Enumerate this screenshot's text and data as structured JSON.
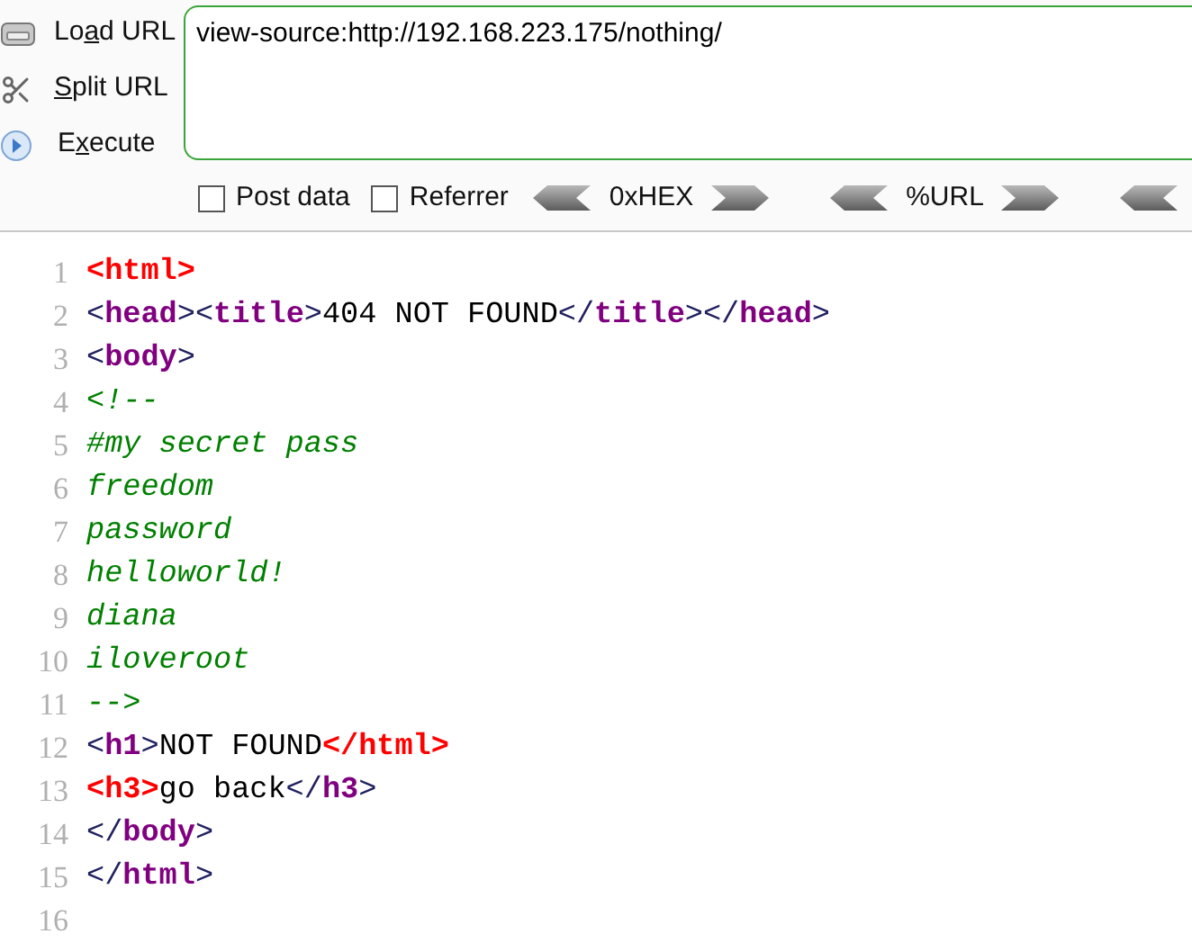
{
  "toolbar": {
    "actions": [
      {
        "kind": "load",
        "label": {
          "before": "Lo",
          "key": "a",
          "after": "d URL"
        }
      },
      {
        "kind": "split",
        "label": {
          "key": "S",
          "after": "plit URL"
        }
      },
      {
        "kind": "execute",
        "label": {
          "before": "E",
          "key": "x",
          "after": "ecute"
        }
      }
    ],
    "url_field": {
      "value": "view-source:http://192.168.223.175/nothing/"
    },
    "options": [
      {
        "label": "Post data",
        "checked": false
      },
      {
        "label": "Referrer",
        "checked": false
      }
    ],
    "converters": [
      {
        "label": "0xHEX"
      },
      {
        "label": "%URL"
      }
    ]
  },
  "source": {
    "lines": [
      {
        "number": "1",
        "tokens": [
          {
            "kind": "error",
            "text": "<html>"
          }
        ]
      },
      {
        "number": "2",
        "tokens": [
          {
            "kind": "bracket",
            "text": "<"
          },
          {
            "kind": "tag",
            "text": "head"
          },
          {
            "kind": "bracket",
            "text": "><"
          },
          {
            "kind": "tag",
            "text": "title"
          },
          {
            "kind": "bracket",
            "text": ">"
          },
          {
            "kind": "text",
            "text": "404 NOT FOUND"
          },
          {
            "kind": "bracket",
            "text": "</"
          },
          {
            "kind": "tag",
            "text": "title"
          },
          {
            "kind": "bracket",
            "text": "></"
          },
          {
            "kind": "tag",
            "text": "head"
          },
          {
            "kind": "bracket",
            "text": ">"
          }
        ]
      },
      {
        "number": "3",
        "tokens": [
          {
            "kind": "bracket",
            "text": "<"
          },
          {
            "kind": "tag",
            "text": "body"
          },
          {
            "kind": "bracket",
            "text": ">"
          }
        ]
      },
      {
        "number": "4",
        "tokens": [
          {
            "kind": "comment",
            "text": "<!--"
          }
        ]
      },
      {
        "number": "5",
        "tokens": [
          {
            "kind": "comment",
            "text": "#my secret pass"
          }
        ]
      },
      {
        "number": "6",
        "tokens": [
          {
            "kind": "comment",
            "text": "freedom"
          }
        ]
      },
      {
        "number": "7",
        "tokens": [
          {
            "kind": "comment",
            "text": "password"
          }
        ]
      },
      {
        "number": "8",
        "tokens": [
          {
            "kind": "comment",
            "text": "helloworld!"
          }
        ]
      },
      {
        "number": "9",
        "tokens": [
          {
            "kind": "comment",
            "text": "diana"
          }
        ]
      },
      {
        "number": "10",
        "tokens": [
          {
            "kind": "comment",
            "text": "iloveroot"
          }
        ]
      },
      {
        "number": "11",
        "tokens": [
          {
            "kind": "comment",
            "text": "-->"
          }
        ]
      },
      {
        "number": "12",
        "tokens": [
          {
            "kind": "bracket",
            "text": "<"
          },
          {
            "kind": "tag",
            "text": "h1"
          },
          {
            "kind": "bracket",
            "text": ">"
          },
          {
            "kind": "text",
            "text": "NOT FOUND"
          },
          {
            "kind": "error",
            "text": "</html>"
          }
        ]
      },
      {
        "number": "13",
        "tokens": [
          {
            "kind": "error",
            "text": "<h3>"
          },
          {
            "kind": "text",
            "text": "go back"
          },
          {
            "kind": "bracket",
            "text": "</"
          },
          {
            "kind": "tag",
            "text": "h3"
          },
          {
            "kind": "bracket",
            "text": ">"
          }
        ]
      },
      {
        "number": "14",
        "tokens": [
          {
            "kind": "bracket",
            "text": "</"
          },
          {
            "kind": "tag",
            "text": "body"
          },
          {
            "kind": "bracket",
            "text": ">"
          }
        ]
      },
      {
        "number": "15",
        "tokens": [
          {
            "kind": "bracket",
            "text": "</"
          },
          {
            "kind": "tag",
            "text": "html"
          },
          {
            "kind": "bracket",
            "text": ">"
          }
        ]
      },
      {
        "number": "16"
      }
    ]
  }
}
